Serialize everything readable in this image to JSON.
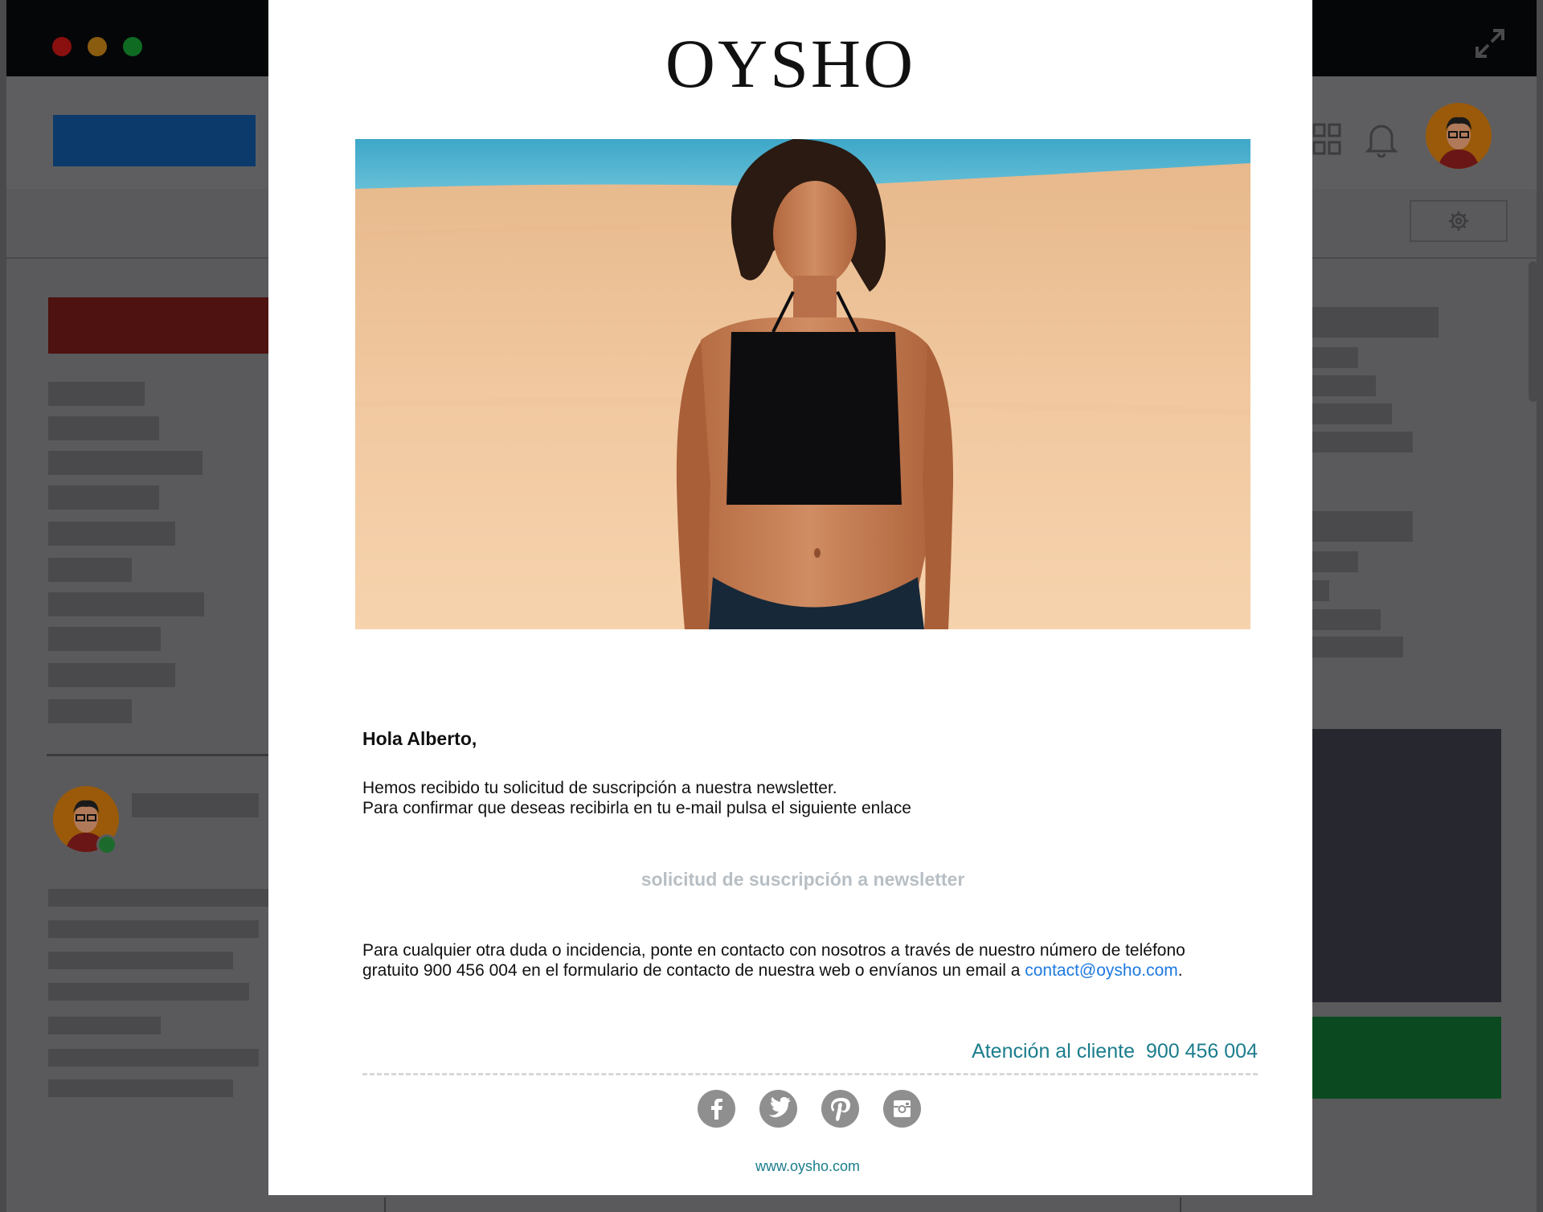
{
  "email": {
    "brand": "OYSHO",
    "greeting": "Hola Alberto,",
    "intro_line1": "Hemos recibido tu solicitud de suscripción a nuestra newsletter.",
    "intro_line2": "Para confirmar que deseas recibirla en tu e-mail pulsa el siguiente enlace",
    "confirm_link": "solicitud de suscripción a newsletter",
    "contact_line1": "Para cualquier otra duda o incidencia, ponte en contacto con nosotros a través de nuestro número de teléfono",
    "contact_line2": "gratuito 900 456 004 en el formulario de contacto de nuestra web o envíanos un email a",
    "contact_email": "contact@oysho.com",
    "contact_period": ".",
    "support_label": "Atención al cliente",
    "support_phone": "900 456 004",
    "website": "www.oysho.com",
    "social": [
      "facebook-icon",
      "twitter-icon",
      "pinterest-icon",
      "instagram-icon"
    ]
  },
  "colors": {
    "accent_teal": "#1b7d8c",
    "link_blue": "#1f7ae0",
    "cta_gray": "#b8bfc4",
    "social_gray": "#8f8f8f"
  }
}
